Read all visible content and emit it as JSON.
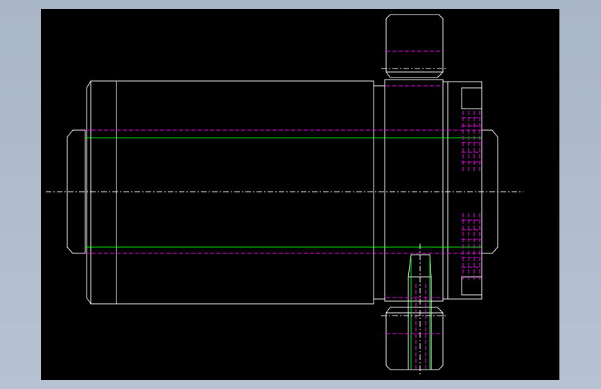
{
  "viewport": {
    "background": "#000000",
    "page_background": "#b0bccc"
  },
  "colors": {
    "outline": "#ffffff",
    "hidden": "#ff00ff",
    "thread": "#00ff00",
    "center": "#ffffff"
  },
  "drawing": {
    "description_icon": "cad-drawing-icon",
    "views": [
      "front-section"
    ]
  }
}
